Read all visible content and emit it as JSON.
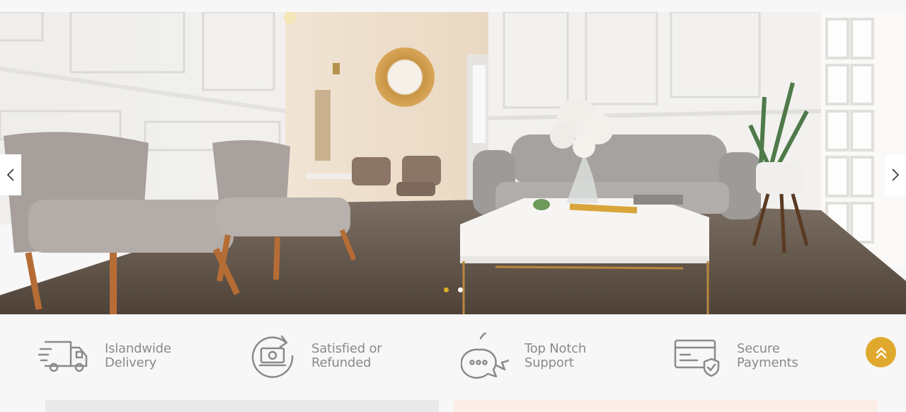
{
  "hero": {
    "slide_alt": "Living room with grey armchairs, sofa and white coffee table",
    "dots": [
      {
        "active": true
      },
      {
        "active": false
      }
    ],
    "prev_icon": "chevron-left-icon",
    "next_icon": "chevron-right-icon"
  },
  "features": [
    {
      "icon": "delivery-truck-icon",
      "line1": "Islandwide",
      "line2": "Delivery"
    },
    {
      "icon": "refund-cycle-icon",
      "line1": "Satisfied or",
      "line2": "Refunded"
    },
    {
      "icon": "chat-support-icon",
      "line1": "Top Notch",
      "line2": "Support"
    },
    {
      "icon": "secure-card-icon",
      "line1": "Secure",
      "line2": "Payments"
    }
  ],
  "scroll_top": {
    "icon": "double-chevron-up-icon"
  },
  "colors": {
    "accent": "#e0a92e",
    "text": "#8a8a8a",
    "background": "#f7f7f7"
  }
}
